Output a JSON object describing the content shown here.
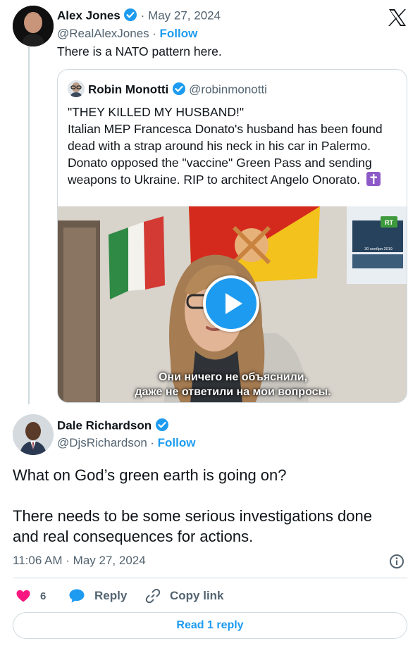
{
  "original_tweet": {
    "author_name": "Alex Jones",
    "date": "May 27, 2024",
    "handle": "@RealAlexJones",
    "follow_label": "Follow",
    "text": "There is a NATO pattern here."
  },
  "quoted_tweet": {
    "author_name": "Robin Monotti",
    "handle": "@robinmonotti",
    "lines": [
      "\"THEY KILLED MY HUSBAND!\"",
      "Italian MEP Francesca Donato's husband has been found",
      "dead with a strap around his neck in his car in Palermo.",
      "Donato opposed the \"vaccine\" Green Pass and sending",
      "weapons to Ukraine. RIP to architect Angelo Onorato."
    ],
    "video": {
      "subtitle_line1": "Они ничего не объяснили,",
      "subtitle_line2": "даже не ответили на мои вопросы.",
      "channel_badge": "RT",
      "poster_date": "30 ноября 2019"
    }
  },
  "reply_tweet": {
    "author_name": "Dale Richardson",
    "handle": "@DjsRichardson",
    "follow_label": "Follow",
    "text_line1": "What on God’s green earth is going on?",
    "text_line2": "There needs to be some serious investigations done",
    "text_line3": "and real consequences for actions.",
    "timestamp": "11:06 AM · May 27, 2024"
  },
  "actions": {
    "like_count": "6",
    "reply_label": "Reply",
    "copy_link_label": "Copy link",
    "read_replies_label": "Read 1 reply"
  },
  "colors": {
    "accent": "#1d9bf0",
    "like": "#f91880",
    "border": "#cfd9de",
    "secondary_text": "#536471"
  }
}
